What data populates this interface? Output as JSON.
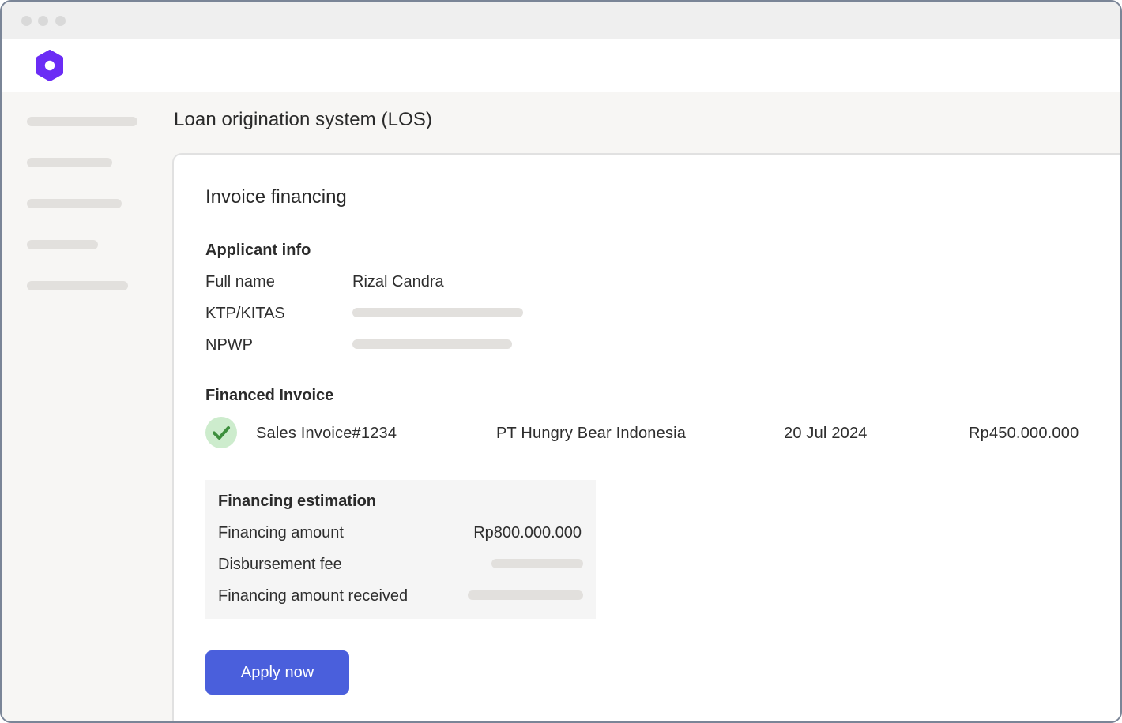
{
  "page": {
    "title": "Loan origination system (LOS)"
  },
  "card": {
    "title": "Invoice financing"
  },
  "applicant_info": {
    "heading": "Applicant info",
    "fields": [
      {
        "label": "Full name",
        "value": "Rizal Candra"
      },
      {
        "label": "KTP/KITAS",
        "value": null
      },
      {
        "label": "NPWP",
        "value": null
      }
    ]
  },
  "financed_invoice": {
    "heading": "Financed Invoice",
    "row": {
      "invoice": "Sales Invoice#1234",
      "company": "PT Hungry Bear Indonesia",
      "date": "20 Jul 2024",
      "amount": "Rp450.000.000",
      "status_icon": "check-icon"
    }
  },
  "financing_estimation": {
    "heading": "Financing estimation",
    "rows": [
      {
        "label": "Financing amount",
        "value": "Rp800.000.000"
      },
      {
        "label": "Disbursement fee",
        "value": null
      },
      {
        "label": "Financing amount received",
        "value": null
      }
    ]
  },
  "actions": {
    "apply_label": "Apply now"
  },
  "icons": {
    "logo": "hexagon-logo-icon"
  },
  "colors": {
    "brand": "#6b2cf5",
    "primary_button": "#4a5fdc",
    "success_bg": "#cdeccd",
    "success_check": "#3d8f3d"
  }
}
